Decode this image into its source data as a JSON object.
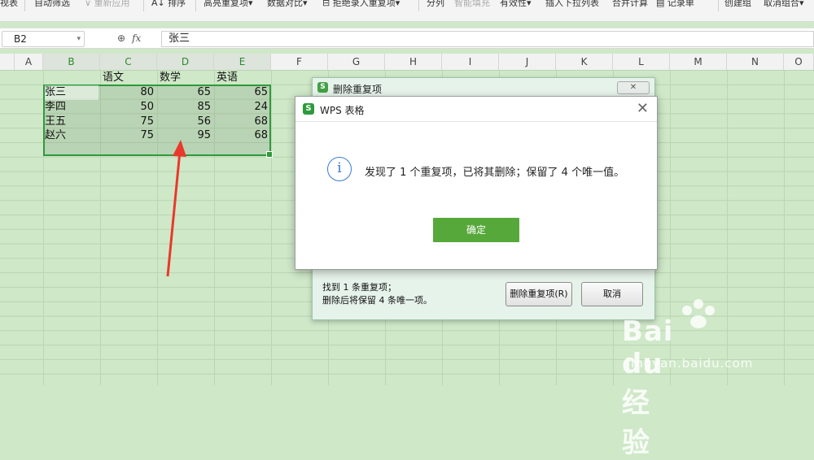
{
  "toolbar": {
    "items": [
      "视表",
      "自动筛选",
      "重新应用",
      "排序",
      "高亮重复项",
      "数据对比",
      "拒绝录入重复项",
      "分列",
      "智能填充",
      "有效性",
      "插入下拉列表",
      "合并计算",
      "记录单",
      "创建组",
      "取消组合"
    ]
  },
  "formula_bar": {
    "name_box": "B2",
    "fx_label": "fx",
    "content": "张三"
  },
  "columns": [
    "A",
    "B",
    "C",
    "D",
    "E",
    "F",
    "G",
    "H",
    "I",
    "J",
    "K",
    "L",
    "M",
    "N",
    "O"
  ],
  "sheet": {
    "headers": [
      "语文",
      "数学",
      "英语"
    ],
    "rows": [
      {
        "name": "张三",
        "chinese": "80",
        "math": "65",
        "english": "65"
      },
      {
        "name": "李四",
        "chinese": "50",
        "math": "85",
        "english": "24"
      },
      {
        "name": "王五",
        "chinese": "75",
        "math": "56",
        "english": "68"
      },
      {
        "name": "赵六",
        "chinese": "75",
        "math": "95",
        "english": "68"
      }
    ]
  },
  "dedupe_dialog": {
    "title": "删除重复项",
    "close_label": "✕",
    "found_text": "找到 1 条重复项；",
    "keep_text": "删除后将保留 4 条唯一项。",
    "delete_button": "删除重复项(R)",
    "cancel_button": "取消"
  },
  "message_dialog": {
    "title": "WPS 表格",
    "message": "发现了 1 个重复项，已将其删除；保留了 4 个唯一值。",
    "ok_button": "确定",
    "icon": "info-icon"
  },
  "watermark": {
    "brand": "Bai du 经验",
    "url": "jingyan.baidu.com"
  },
  "colors": {
    "sheet_bg": "#cfe8c8",
    "selection_border": "#2e9a3b",
    "ok_button": "#56a83a",
    "info_icon": "#3a7bd5",
    "arrow": "#e8392b"
  }
}
